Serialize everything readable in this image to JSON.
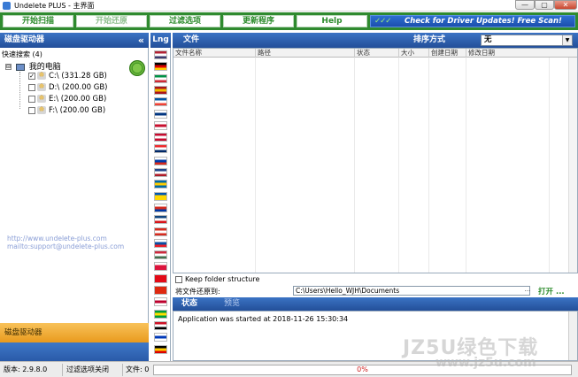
{
  "window": {
    "title": "Undelete PLUS - 主界面",
    "min_glyph": "—",
    "max_glyph": "▢",
    "close_glyph": "✕"
  },
  "toolbar": {
    "start_scan": "开始扫描",
    "start_restore": "开始还原",
    "filter_options": "过滤选项",
    "update": "更新程序",
    "help": "Help",
    "driver_checks": "✓✓✓",
    "driver_updates": "Check for Driver Updates! Free Scan!"
  },
  "left_panel": {
    "header": "磁盘驱动器",
    "collapse_glyph": "«",
    "quick_search": "快速搜索 (4)",
    "tree_root_expander": "⊟",
    "tree_root_label": "我的电脑",
    "drives": [
      {
        "label": "C:\\  (331.28 GB)",
        "checked": true
      },
      {
        "label": "D:\\  (200.00 GB)",
        "checked": false
      },
      {
        "label": "E:\\  (200.00 GB)",
        "checked": false
      },
      {
        "label": "F:\\  (200.00 GB)",
        "checked": false
      }
    ],
    "links": [
      "http://www.undelete-plus.com",
      "mailto:support@undelete-plus.com"
    ],
    "footer_label": "磁盘驱动器"
  },
  "language": {
    "header": "Lng",
    "flags": [
      [
        "#b22234",
        "#fff",
        "#3c3b6e"
      ],
      [
        "#000",
        "#dd0000",
        "#ffce00"
      ],
      [
        "#009246",
        "#fff",
        "#ce2b37"
      ],
      [
        "#aa151b",
        "#f1bf00",
        "#aa151b"
      ],
      [
        "#0055a4",
        "#fff",
        "#ef4135"
      ],
      [
        "#fff",
        "#003580",
        "#fff"
      ],
      [
        "#fff",
        "#c8102e",
        "#fff"
      ],
      [
        "#c60c30",
        "#fff",
        "#c60c30"
      ],
      [
        "#ef2b2d",
        "#fff",
        "#002868"
      ],
      [
        "#fff",
        "#0039a6",
        "#d52b1e"
      ],
      [
        "#21468b",
        "#fff",
        "#ae1c28"
      ],
      [
        "#006aa7",
        "#fecc00",
        "#006aa7"
      ],
      [
        "#0057b7",
        "#ffd700",
        "#ffd700"
      ],
      [
        "#fff",
        "#d52b1e",
        "#0039a6"
      ],
      [
        "#11457e",
        "#fff",
        "#d7141a"
      ],
      [
        "#d52b1e",
        "#fff",
        "#d52b1e"
      ],
      [
        "#fff",
        "#0b4ea2",
        "#ee1c25"
      ],
      [
        "#cd2a3e",
        "#fff",
        "#436f4d"
      ],
      [
        "#fff",
        "#dc143c",
        "#dc143c"
      ],
      [
        "#e30a17",
        "#e30a17",
        "#e30a17"
      ],
      [
        "#de2910",
        "#de2910",
        "#de2910"
      ],
      [
        "#fff",
        "#bc002d",
        "#fff"
      ],
      [
        "#009c3b",
        "#ffdf00",
        "#009c3b"
      ],
      [
        "#ce1126",
        "#fff",
        "#000"
      ],
      [
        "#fff",
        "#0038b8",
        "#fff"
      ],
      [
        "#000",
        "#ffce00",
        "#dd0000"
      ]
    ]
  },
  "main": {
    "files_header": "文件",
    "sort_label": "排序方式",
    "sort_value": "无",
    "sort_arrow": "▼",
    "columns": [
      "文件名称",
      "路径",
      "状态",
      "大小",
      "创建日期",
      "修改日期"
    ],
    "keep_folder_label": "Keep folder structure",
    "restore_to_label": "将文件还原到:",
    "restore_path": "C:\\Users\\Hello_WJH\\Documents",
    "browse_glyph": "...",
    "open_label": "打开 ..."
  },
  "status": {
    "tab_status": "状态",
    "tab_preview": "预览",
    "log_message": "Application was started at 2018-11-26 15:30:34"
  },
  "statusbar": {
    "version": "版本: 2.9.8.0",
    "filter": "过滤选项关闭",
    "files": "文件: 0",
    "progress_percent": 0,
    "progress_label": "0%"
  },
  "watermark": {
    "main": "JZ5U绿色下载",
    "sub": "www.jz5u.com"
  }
}
